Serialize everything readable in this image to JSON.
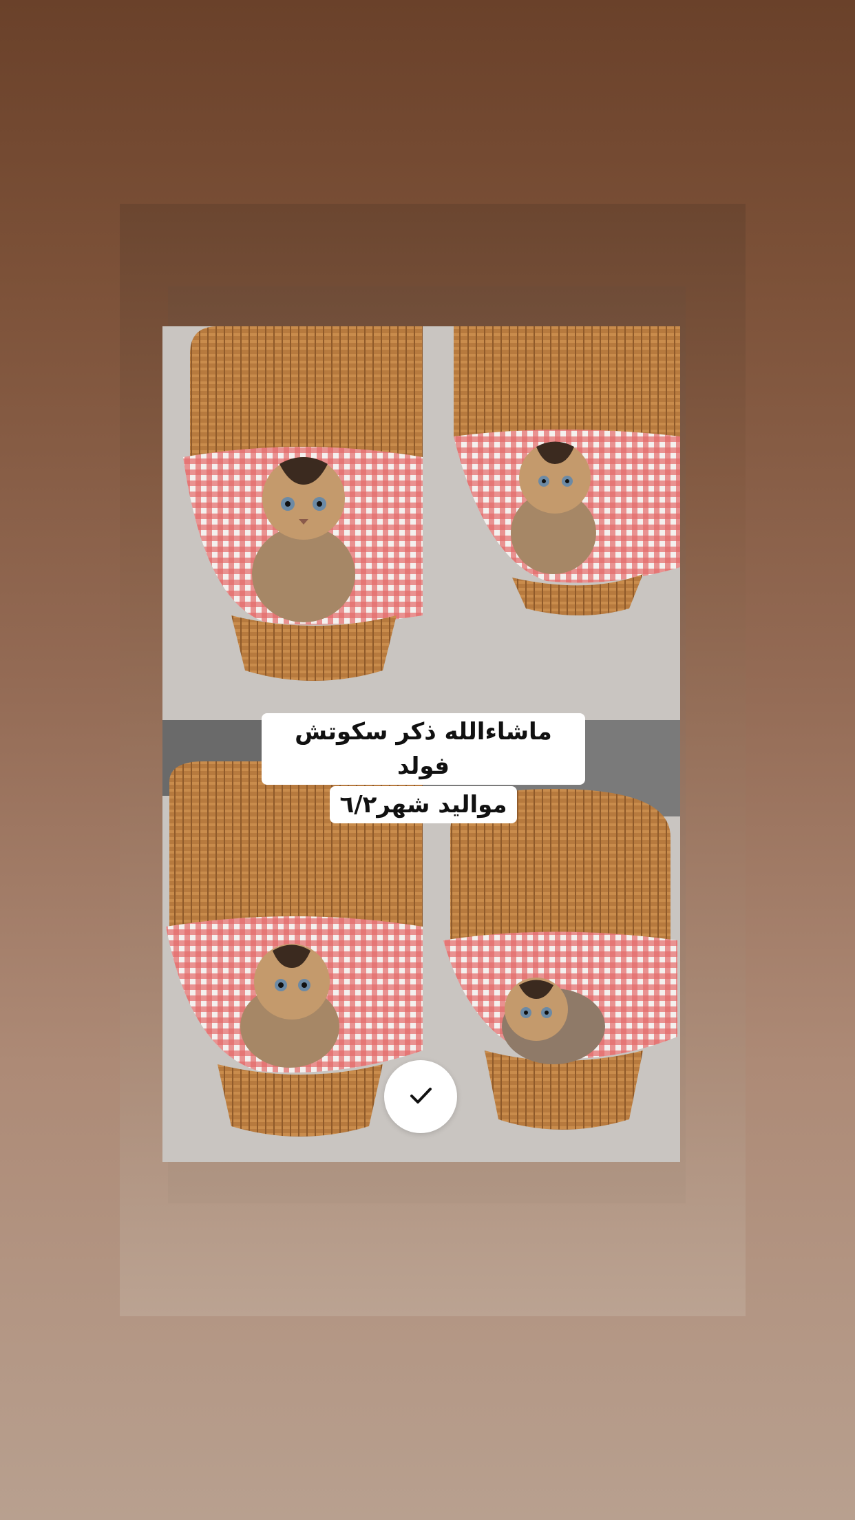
{
  "story": {
    "caption_line1": "ماشاءالله ذكر سكوتش فولد",
    "caption_line2": "مواليد شهر٦/٢"
  },
  "photos": [
    {
      "name": "kitten-basket-photo-1"
    },
    {
      "name": "kitten-basket-photo-2"
    },
    {
      "name": "kitten-basket-photo-3"
    },
    {
      "name": "kitten-basket-photo-4"
    }
  ],
  "icons": {
    "confirm": "check-icon"
  },
  "colors": {
    "background_top": "#6a412a",
    "background_bottom": "#b8a08f",
    "caption_bg": "#ffffff",
    "button_bg": "#ffffff"
  }
}
